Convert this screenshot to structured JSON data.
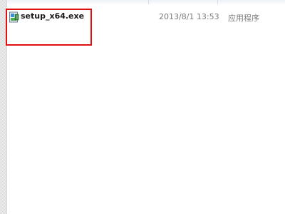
{
  "file_list": {
    "files": [
      {
        "name": "setup_x64.exe",
        "modified": "2013/8/1 13:53",
        "type": "应用程序",
        "icon": "installer-icon"
      }
    ]
  },
  "annotation": {
    "highlight_color": "#e01010"
  }
}
